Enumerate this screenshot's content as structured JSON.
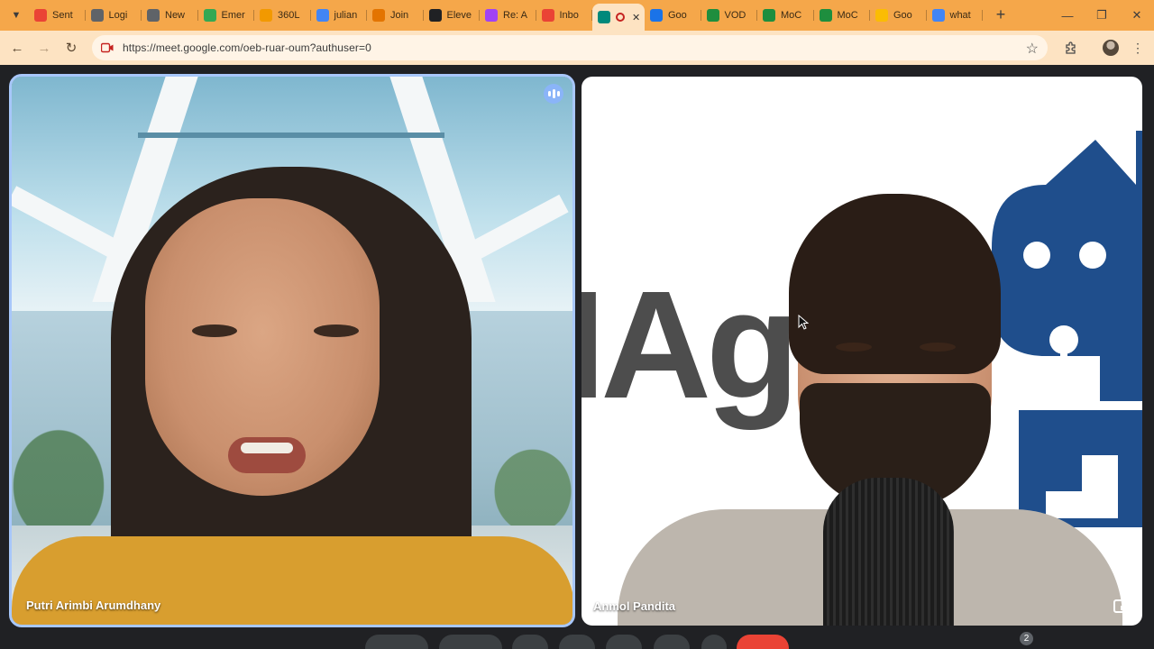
{
  "browser": {
    "tabs": [
      {
        "label": "Sent",
        "icon": "gmail-icon",
        "color": "#ea4335"
      },
      {
        "label": "Logi",
        "icon": "info-icon",
        "color": "#5f6368"
      },
      {
        "label": "New",
        "icon": "info-icon",
        "color": "#5f6368"
      },
      {
        "label": "Emer",
        "icon": "emerald-icon",
        "color": "#34a853"
      },
      {
        "label": "360L",
        "icon": "sync-icon",
        "color": "#f29900"
      },
      {
        "label": "julian",
        "icon": "google-icon",
        "color": "#4285f4"
      },
      {
        "label": "Join",
        "icon": "join-icon",
        "color": "#e37400"
      },
      {
        "label": "Eleve",
        "icon": "elevenlabs-icon",
        "color": "#202124"
      },
      {
        "label": "Re: A",
        "icon": "hub-icon",
        "color": "#a142f4"
      },
      {
        "label": "Inbo",
        "icon": "gmail-icon",
        "color": "#ea4335"
      },
      {
        "label": "",
        "icon": "meet-icon",
        "color": "#00897b"
      },
      {
        "label": "Goo",
        "icon": "calendar-icon",
        "color": "#1a73e8"
      },
      {
        "label": "VOD",
        "icon": "k-icon",
        "color": "#1e8e3e"
      },
      {
        "label": "MoC",
        "icon": "k-icon",
        "color": "#1e8e3e"
      },
      {
        "label": "MoC",
        "icon": "k-icon",
        "color": "#1e8e3e"
      },
      {
        "label": "Goo",
        "icon": "gmail-icon",
        "color": "#fbbc04"
      },
      {
        "label": "what",
        "icon": "google-icon",
        "color": "#4285f4"
      }
    ],
    "url": "https://meet.google.com/oeb-ruar-oum?authuser=0"
  },
  "meet": {
    "participants": [
      {
        "name": "Putri Arimbi Arumdhany",
        "speaking": true
      },
      {
        "name": "Anmol Pandita",
        "speaking": false
      }
    ],
    "background_text": "IAg",
    "people_count": "2"
  },
  "colors": {
    "tabstrip": "#f5a74a",
    "toolbar": "#fde3c2",
    "stage": "#202124",
    "active_speaker_border": "#a8c7fa",
    "end_call": "#ea4335"
  }
}
